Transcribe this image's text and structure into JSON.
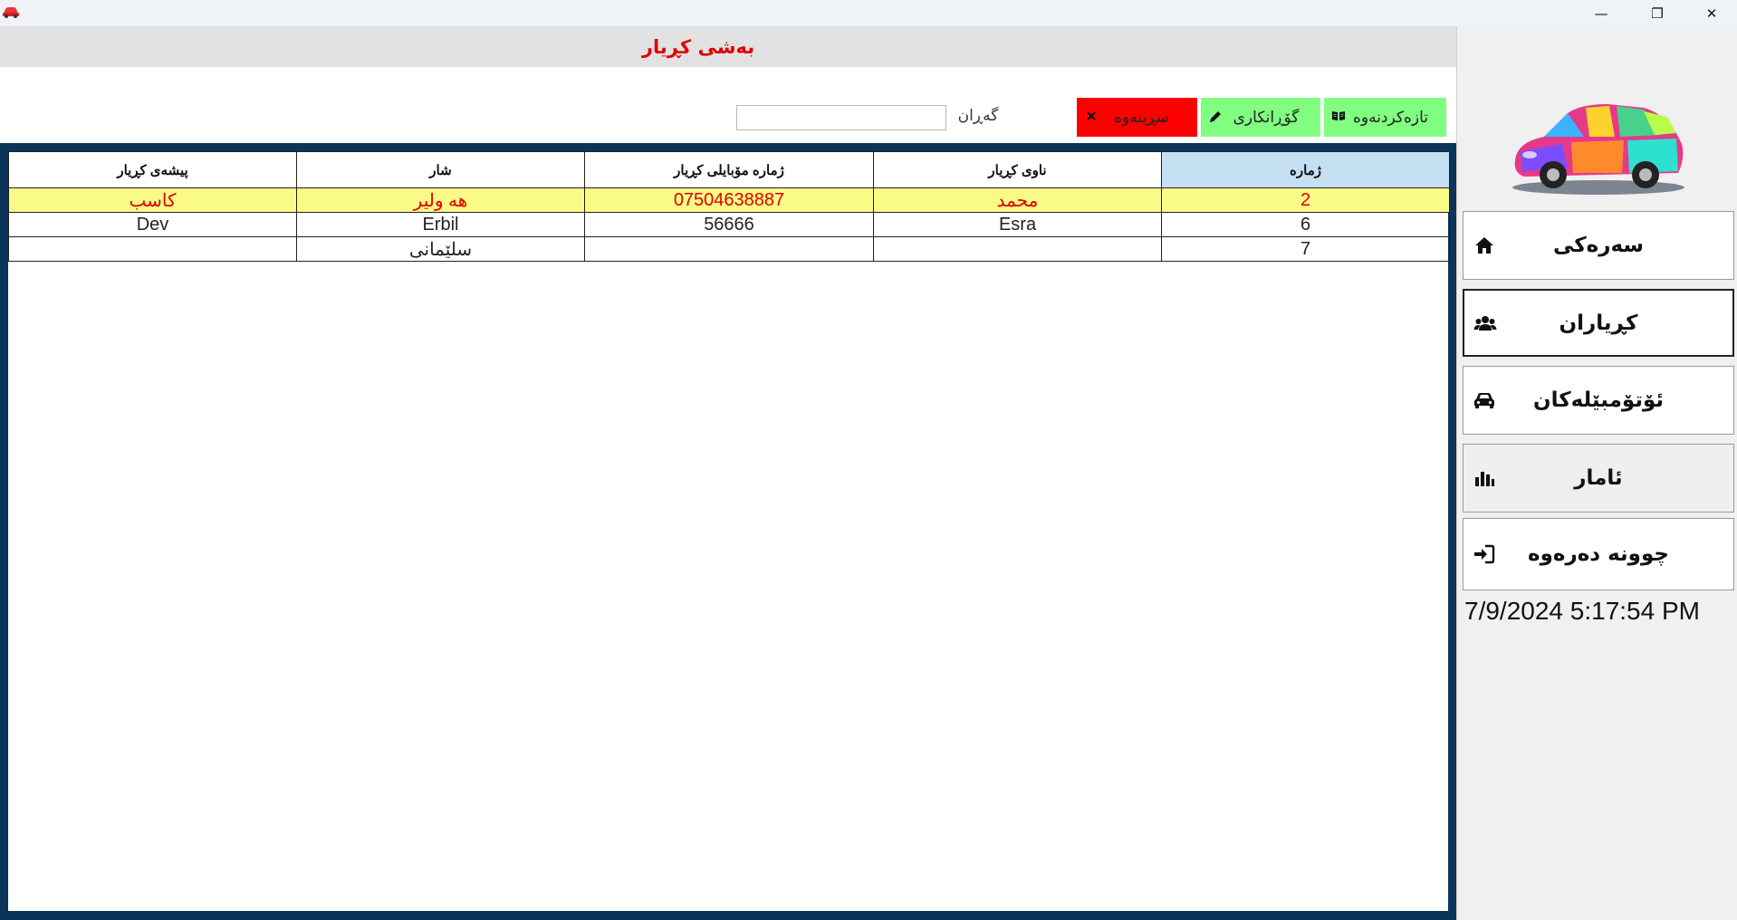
{
  "window": {
    "minimize_glyph": "—",
    "maximize_glyph": "❐",
    "close_glyph": "✕"
  },
  "page": {
    "title": "بەشی کڕیار"
  },
  "toolbar": {
    "refresh_label": "تازەکردنەوە",
    "edit_label": "گۆڕانکاری",
    "delete_label": "سڕینەوە",
    "search_label": "گەڕان",
    "search_value": "",
    "refresh_icon": "book-open-icon",
    "edit_icon": "pencil-icon",
    "delete_icon": "close-icon",
    "colors": {
      "refresh": "#80ff80",
      "edit": "#80ff80",
      "delete": "#ff0000"
    }
  },
  "table": {
    "headers": [
      "پیشەی کڕیار",
      "شار",
      "ژمارە مۆبایلی کڕیار",
      "ناوی کڕیار",
      "ژمارە"
    ],
    "rows": [
      [
        "کاسب",
        "هە ولیر",
        "07504638887",
        "محمد",
        "2"
      ],
      [
        "Dev",
        "Erbil",
        "56666",
        "Esra",
        "6"
      ],
      [
        "",
        "سلێمانی",
        "",
        "",
        "7"
      ]
    ],
    "selected_row_color": "#fafa86",
    "selected_text_color": "#e00000"
  },
  "sidebar": {
    "nav": [
      {
        "label": "سەرەکی",
        "icon": "home-icon"
      },
      {
        "label": "کڕیاران",
        "icon": "users-icon"
      },
      {
        "label": "ئۆتۆمبێلەکان",
        "icon": "car-icon"
      },
      {
        "label": "ئامار",
        "icon": "bar-chart-icon"
      },
      {
        "label": "چوونە دەرەوە",
        "icon": "sign-in-icon"
      }
    ],
    "clock": "7/9/2024 5:17:54 PM"
  }
}
